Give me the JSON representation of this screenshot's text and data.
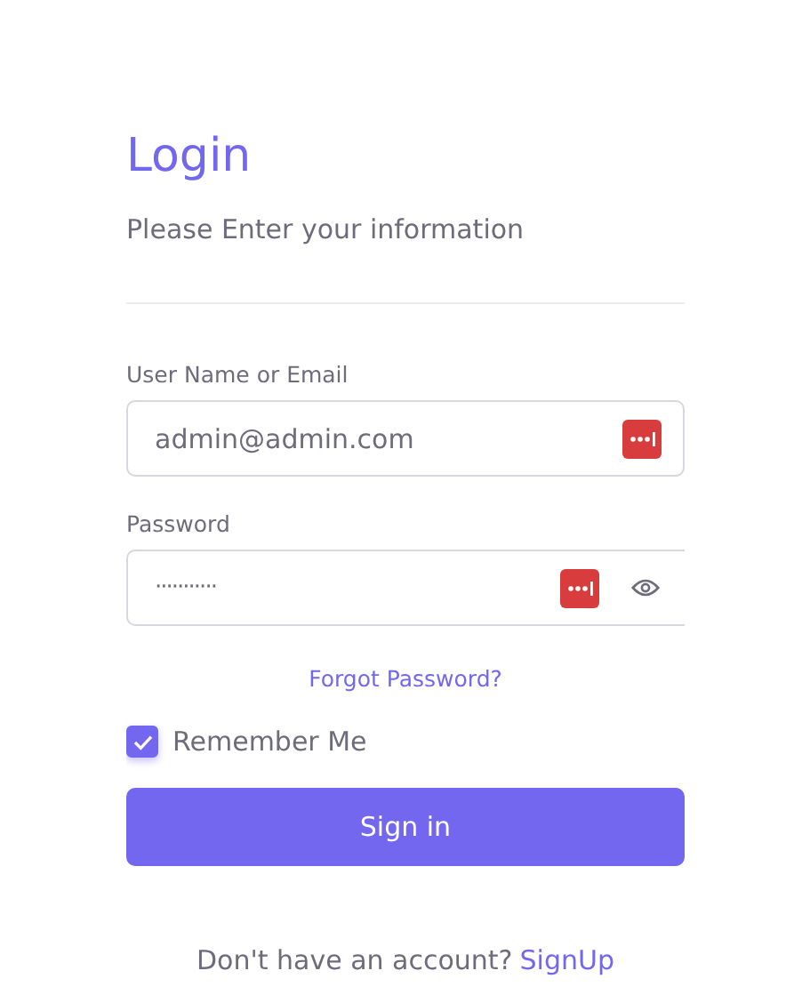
{
  "title": "Login",
  "subtitle": "Please Enter your information",
  "fields": [
    {
      "label": "User Name or Email",
      "value": "admin@admin.com",
      "kind": "text"
    },
    {
      "label": "Password",
      "value": "···········",
      "kind": "password"
    }
  ],
  "forgot_link": "Forgot Password?",
  "remember": {
    "label": "Remember Me",
    "checked": true
  },
  "submit": "Sign in",
  "footer": {
    "text": "Don't have an account?",
    "link": "SignUp"
  }
}
